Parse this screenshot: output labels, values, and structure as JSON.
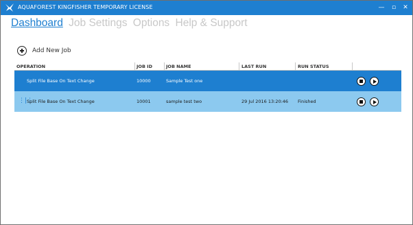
{
  "window": {
    "title": "AQUAFOREST KINGFISHER TEMPORARY LICENSE",
    "minimize_glyph": "—",
    "restore_glyph": "▫",
    "close_glyph": "✕"
  },
  "nav": {
    "tabs": [
      {
        "label": "Dashboard",
        "active": true
      },
      {
        "label": "Job Settings",
        "active": false
      },
      {
        "label": "Options",
        "active": false
      },
      {
        "label": "Help & Support",
        "active": false
      }
    ]
  },
  "toolbar": {
    "add_job_label": "Add New Job"
  },
  "jobs_table": {
    "columns": [
      "OPERATION",
      "JOB ID",
      "JOB NAME",
      "LAST RUN",
      "RUN STATUS"
    ],
    "rows": [
      {
        "operation": "Split File Base On Text Change",
        "job_id": "10000",
        "job_name": "Sample Test one",
        "last_run": "",
        "run_status": "",
        "selected": true
      },
      {
        "operation": "Split File Base On Text Change",
        "job_id": "10001",
        "job_name": "sample test two",
        "last_run": "29 Jul 2016 13:20:46",
        "run_status": "Finished",
        "selected": false
      }
    ]
  },
  "colors": {
    "accent": "#1e7fd0",
    "selected_row": "#1e7fd0",
    "row_alt": "#8cc9ef",
    "inactive_tab": "#c8c8c8"
  }
}
